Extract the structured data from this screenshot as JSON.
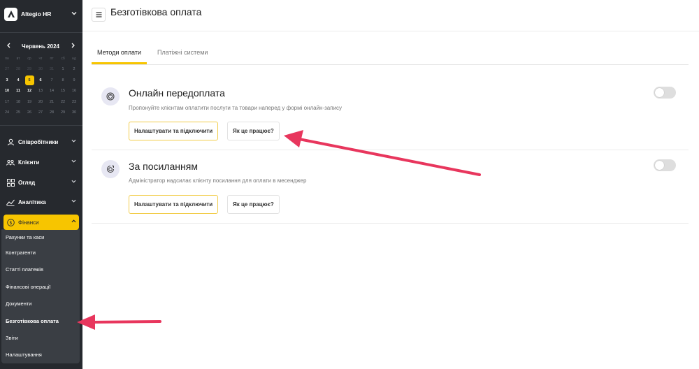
{
  "sidebar": {
    "brand": "Altegio HR",
    "calendar": {
      "month": "Червень 2024",
      "weekdays": [
        "пн",
        "вт",
        "ср",
        "чт",
        "пт",
        "сб",
        "нд"
      ],
      "days": [
        {
          "d": "27",
          "t": "prev"
        },
        {
          "d": "28",
          "t": "prev"
        },
        {
          "d": "29",
          "t": "prev"
        },
        {
          "d": "30",
          "t": "prev"
        },
        {
          "d": "31",
          "t": "prev"
        },
        {
          "d": "1",
          "t": "norm"
        },
        {
          "d": "2",
          "t": "norm"
        },
        {
          "d": "3",
          "t": "cur"
        },
        {
          "d": "4",
          "t": "cur"
        },
        {
          "d": "5",
          "t": "today"
        },
        {
          "d": "6",
          "t": "cur"
        },
        {
          "d": "7",
          "t": "norm"
        },
        {
          "d": "8",
          "t": "norm"
        },
        {
          "d": "9",
          "t": "norm"
        },
        {
          "d": "10",
          "t": "cur"
        },
        {
          "d": "11",
          "t": "cur"
        },
        {
          "d": "12",
          "t": "cur"
        },
        {
          "d": "13",
          "t": "norm"
        },
        {
          "d": "14",
          "t": "norm"
        },
        {
          "d": "15",
          "t": "norm"
        },
        {
          "d": "16",
          "t": "norm"
        },
        {
          "d": "17",
          "t": "norm"
        },
        {
          "d": "18",
          "t": "norm"
        },
        {
          "d": "19",
          "t": "norm"
        },
        {
          "d": "20",
          "t": "norm"
        },
        {
          "d": "21",
          "t": "norm"
        },
        {
          "d": "22",
          "t": "norm"
        },
        {
          "d": "23",
          "t": "norm"
        },
        {
          "d": "24",
          "t": "norm"
        },
        {
          "d": "25",
          "t": "norm"
        },
        {
          "d": "26",
          "t": "norm"
        },
        {
          "d": "27",
          "t": "norm"
        },
        {
          "d": "28",
          "t": "norm"
        },
        {
          "d": "29",
          "t": "norm"
        },
        {
          "d": "30",
          "t": "norm"
        }
      ]
    },
    "nav": [
      {
        "label": "Співробітники",
        "icon": "person-icon"
      },
      {
        "label": "Клієнти",
        "icon": "clients-icon"
      },
      {
        "label": "Огляд",
        "icon": "grid-icon"
      },
      {
        "label": "Аналітика",
        "icon": "analytics-icon"
      },
      {
        "label": "Фінанси",
        "icon": "dollar-icon"
      }
    ],
    "finance_submenu": [
      "Рахунки та каси",
      "Контрагенти",
      "Статті платежів",
      "Фінансові операції",
      "Документи",
      "Безготівкова оплата",
      "Звіти",
      "Налаштування"
    ]
  },
  "header": {
    "title": "Безготівкова оплата"
  },
  "tabs": [
    "Методи оплати",
    "Платіжні системи"
  ],
  "methods": [
    {
      "title": "Онлайн передоплата",
      "description": "Пропонуйте клієнтам оплатити послуги та товари наперед у формі онлайн-запису",
      "primary": "Налаштувати та підключити",
      "secondary": "Як це працює?",
      "enabled": false
    },
    {
      "title": "За посиланням",
      "description": "Адміністратор надсилає клієнту посилання для оплати в месенджер",
      "primary": "Налаштувати та підключити",
      "secondary": "Як це працює?",
      "enabled": false
    }
  ],
  "colors": {
    "accent": "#f7c500",
    "sidebar": "#26292e",
    "arrow": "#e8365d"
  }
}
